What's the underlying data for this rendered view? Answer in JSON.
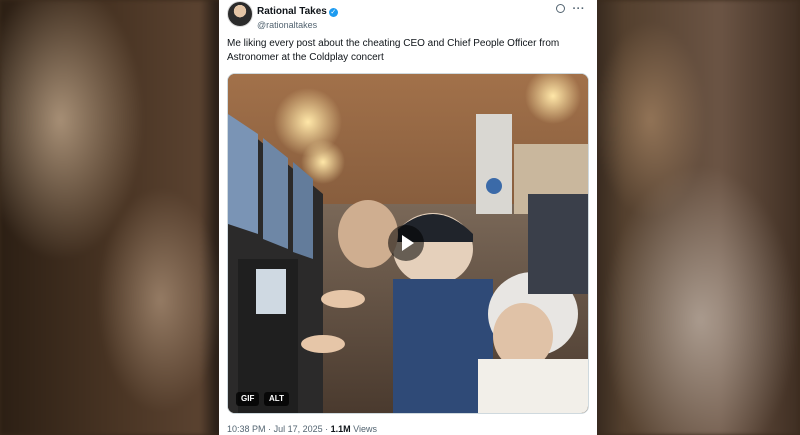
{
  "tweet": {
    "author": {
      "display_name": "Rational Takes",
      "handle": "@rationaltakes",
      "verified": true
    },
    "text": "Me liking every post about the cheating CEO and Chief People Officer from Astronomer at the Coldplay concert",
    "media": {
      "badges": {
        "gif": "GIF",
        "alt": "ALT"
      },
      "play_icon": "play-icon"
    },
    "footer": {
      "time": "10:38 PM",
      "separator": "·",
      "date": "Jul 17, 2025",
      "views_count": "1.1M",
      "views_label": "Views"
    }
  },
  "colors": {
    "text": "#0f1419",
    "muted": "#536471",
    "verified": "#1d9bf0"
  }
}
